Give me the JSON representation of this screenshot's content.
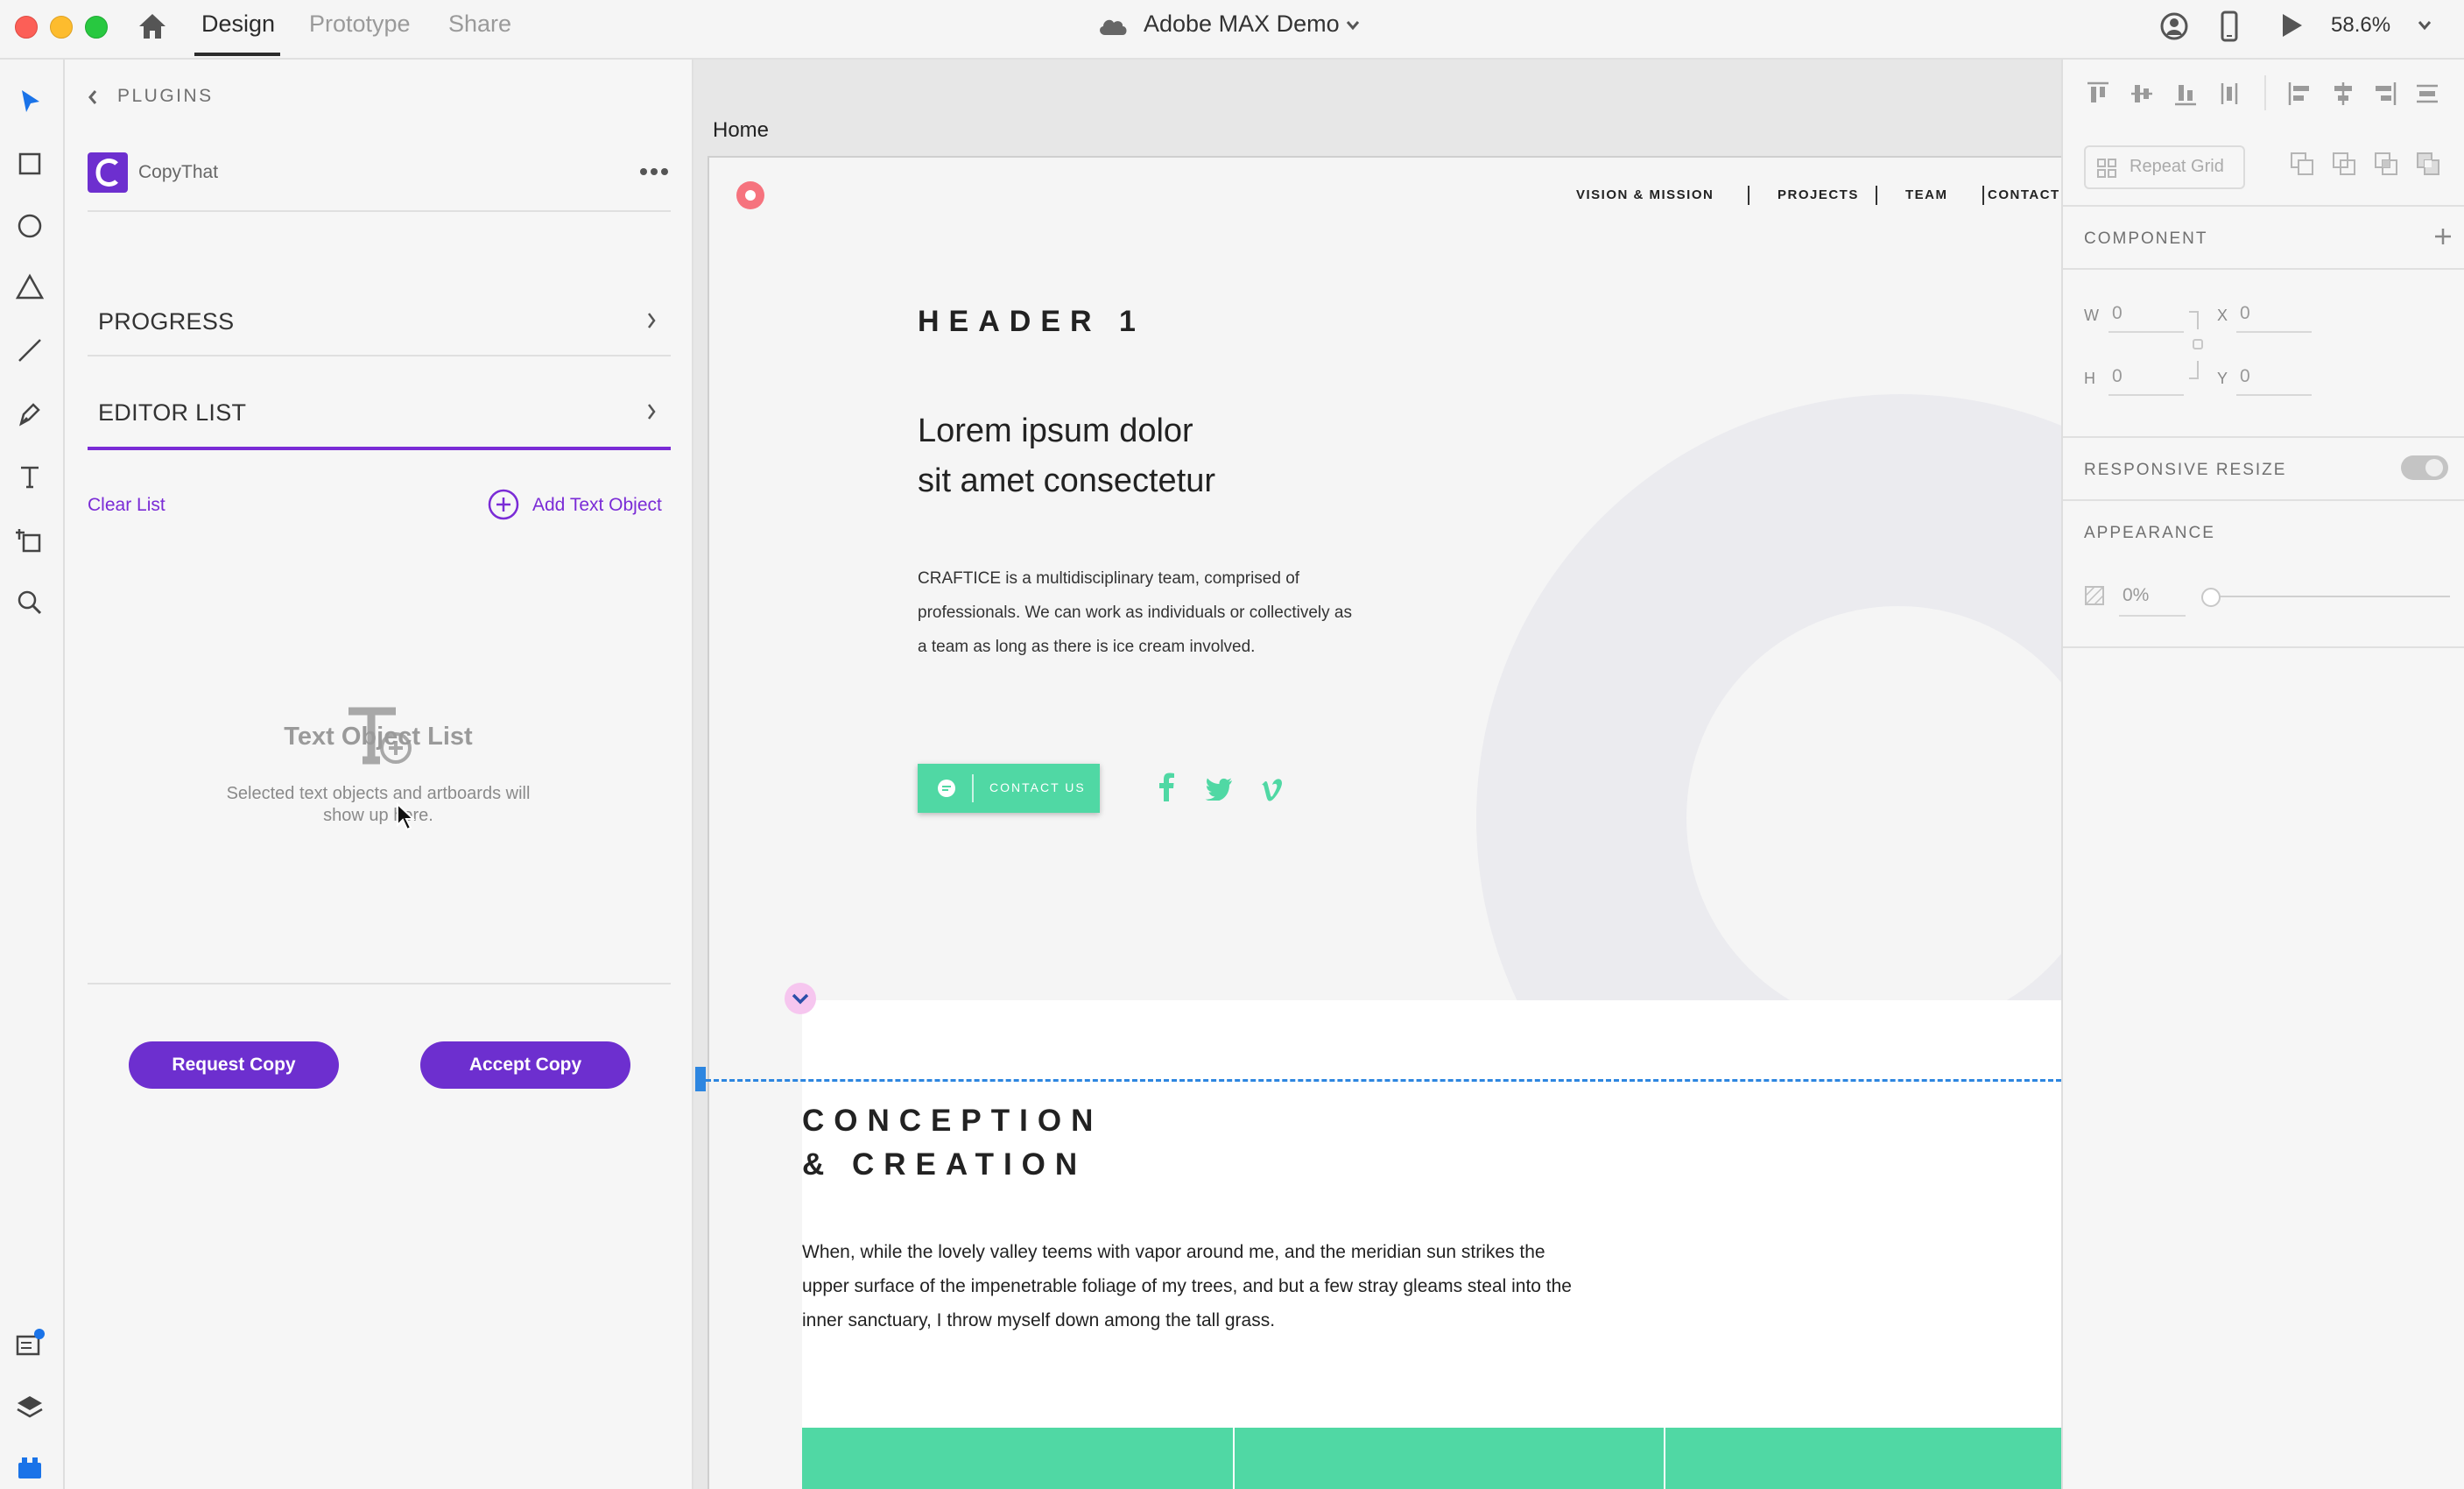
{
  "titlebar": {
    "tabs": [
      "Design",
      "Prototype",
      "Share"
    ],
    "document_title": "Adobe MAX Demo",
    "zoom": "58.6%"
  },
  "plugin_panel": {
    "header": "PLUGINS",
    "plugin_name": "CopyThat",
    "rows": [
      "PROGRESS",
      "EDITOR LIST"
    ],
    "clear_list": "Clear List",
    "add_text_object": "Add Text Object",
    "empty_title": "Text Object List",
    "empty_text_line1": "Selected text objects and artboards will",
    "empty_text_line2": "show up here.",
    "request_copy": "Request Copy",
    "accept_copy": "Accept Copy",
    "accent_color": "#6d2fcf"
  },
  "canvas": {
    "artboard_name": "Home",
    "nav": [
      "VISION & MISSION",
      "PROJECTS",
      "TEAM",
      "CONTACT"
    ],
    "header1": "HEADER 1",
    "lorem_line1": "Lorem ipsum dolor",
    "lorem_line2": "sit amet consectetur",
    "body_copy": "CRAFTICE is a multidisciplinary team, comprised of professionals. We can work as individuals or collectively as a team as long as there is ice cream involved.",
    "cta": "CONTACT US",
    "social_icons": [
      "facebook-icon",
      "twitter-icon",
      "vimeo-icon"
    ],
    "section2_line1": "CONCEPTION",
    "section2_line2": "& CREATION",
    "section2_body": "When, while the lovely valley teems with vapor around me, and the meridian sun strikes the upper surface of the impenetrable foliage of my trees, and but a few stray gleams steal into the inner sanctuary, I throw myself down among the tall grass.",
    "brand_green": "#50d8a4"
  },
  "property_panel": {
    "repeat_grid": "Repeat Grid",
    "component": "COMPONENT",
    "w_label": "W",
    "w_value": "0",
    "x_label": "X",
    "x_value": "0",
    "h_label": "H",
    "h_value": "0",
    "y_label": "Y",
    "y_value": "0",
    "responsive_resize": "RESPONSIVE RESIZE",
    "appearance": "APPEARANCE",
    "opacity": "0%"
  }
}
